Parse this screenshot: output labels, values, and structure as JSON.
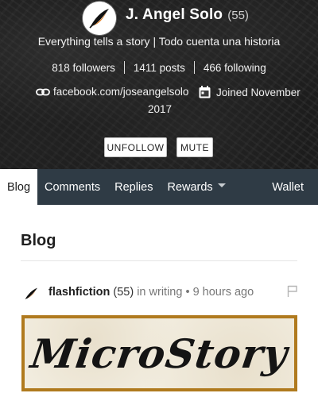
{
  "profile": {
    "name": "J. Angel Solo",
    "reputation": "(55)",
    "about": "Everything tells a story | Todo cuenta una historia",
    "stats": {
      "followers": "818 followers",
      "posts": "1411 posts",
      "following": "466 following"
    },
    "website": "facebook.com/joseangelsolo",
    "website_icon": "link-icon",
    "joined_line1": "Joined November",
    "joined_line2": "2017",
    "joined_icon": "calendar-icon",
    "buttons": {
      "unfollow": "UNFOLLOW",
      "mute": "MUTE"
    }
  },
  "nav": {
    "items": [
      {
        "label": "Blog",
        "active": true
      },
      {
        "label": "Comments"
      },
      {
        "label": "Replies"
      },
      {
        "label": "Rewards",
        "dropdown": true
      }
    ],
    "wallet": "Wallet",
    "colors": {
      "bar": "#2f3b45",
      "active_bg": "#ffffff"
    }
  },
  "blog": {
    "section_title": "Blog",
    "post": {
      "author": "flashfiction",
      "reputation": "(55)",
      "category_prefix": "in",
      "category": "writing",
      "separator": "•",
      "time": "9 hours ago",
      "flag_icon": "flag-icon",
      "image_text": "MicroStory",
      "image_border_color": "#b07a1e"
    }
  }
}
